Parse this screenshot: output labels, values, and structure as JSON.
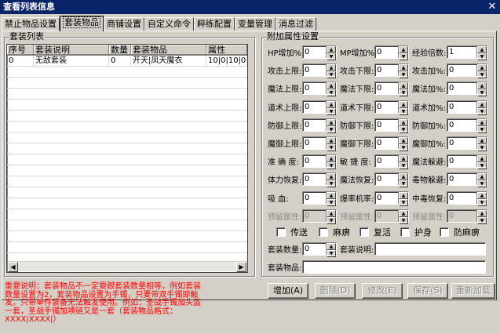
{
  "window": {
    "title": "查看列表信息",
    "close": "✕"
  },
  "tabs": [
    "禁止物品设置",
    "套装物品",
    "商铺设置",
    "自定义命令",
    "粹练配置",
    "变量管理",
    "消息过滤"
  ],
  "list": {
    "title": "套装列表",
    "columns": [
      "序号",
      "套装说明",
      "数量",
      "套装物品",
      "属性"
    ],
    "rows": [
      {
        "id": "0",
        "desc": "无敌套装",
        "count": "0",
        "items": "开天|凤天魔衣",
        "attr": "10|0|10|0|0|0|"
      }
    ]
  },
  "attr": {
    "title": "附加属性设置",
    "fields": [
      {
        "label": "HP增加%:",
        "value": "0"
      },
      {
        "label": "MP增加%:",
        "value": "0"
      },
      {
        "label": "经验倍数:",
        "value": "1"
      },
      {
        "label": "攻击上限:",
        "value": "0"
      },
      {
        "label": "攻击下限:",
        "value": "0"
      },
      {
        "label": "攻击加%:",
        "value": "0"
      },
      {
        "label": "魔法上限:",
        "value": "0"
      },
      {
        "label": "魔法下限:",
        "value": "0"
      },
      {
        "label": "魔法加%:",
        "value": "0"
      },
      {
        "label": "道术上限:",
        "value": "0"
      },
      {
        "label": "道术下限:",
        "value": "0"
      },
      {
        "label": "道术加%:",
        "value": "0"
      },
      {
        "label": "防御上限:",
        "value": "0"
      },
      {
        "label": "防御下限:",
        "value": "0"
      },
      {
        "label": "防御加%:",
        "value": "0"
      },
      {
        "label": "魔御上限:",
        "value": "0"
      },
      {
        "label": "魔御下限:",
        "value": "0"
      },
      {
        "label": "魔御加%:",
        "value": "0"
      },
      {
        "label": "准 确 度:",
        "value": "0"
      },
      {
        "label": "敏 捷 度:",
        "value": "0"
      },
      {
        "label": "魔法躲避:",
        "value": "0"
      },
      {
        "label": "体力恢复:",
        "value": "0"
      },
      {
        "label": "魔法恢复:",
        "value": "0"
      },
      {
        "label": "毒物躲避:",
        "value": "0"
      },
      {
        "label": "吸    血:",
        "value": "0"
      },
      {
        "label": "爆率机率:",
        "value": "0"
      },
      {
        "label": "中毒恢复:",
        "value": "0"
      },
      {
        "label": "预留属性:",
        "value": "0",
        "disabled": true
      },
      {
        "label": "预留属性:",
        "value": "0",
        "disabled": true
      },
      {
        "label": "预留属性:",
        "value": "0",
        "disabled": true
      }
    ],
    "checkboxes": [
      "传送",
      "麻痹",
      "复活",
      "护身",
      "防麻痹"
    ],
    "set_count_label": "套装数量:",
    "set_count_value": "0",
    "set_desc_label": "套装说明:",
    "set_desc_value": "",
    "set_items_label": "套装物品:",
    "set_items_value": ""
  },
  "notes": "重要说明：套装物品不一定要跟套装数量相等，例如套装数量设置为2，套装物品设置为手镯，只要带双手镯即触发。只带单件装备无法触发使用。例如：圣战手镯加头盔一套，圣战手镯加项链又是一套（套装物品格式：XXXX|XXXX|）",
  "buttons": [
    {
      "label": "增加(A)",
      "disabled": false
    },
    {
      "label": "删除(D)",
      "disabled": true
    },
    {
      "label": "修改(E)",
      "disabled": true
    },
    {
      "label": "保存(S)",
      "disabled": true
    },
    {
      "label": "重新加载",
      "disabled": true
    }
  ]
}
